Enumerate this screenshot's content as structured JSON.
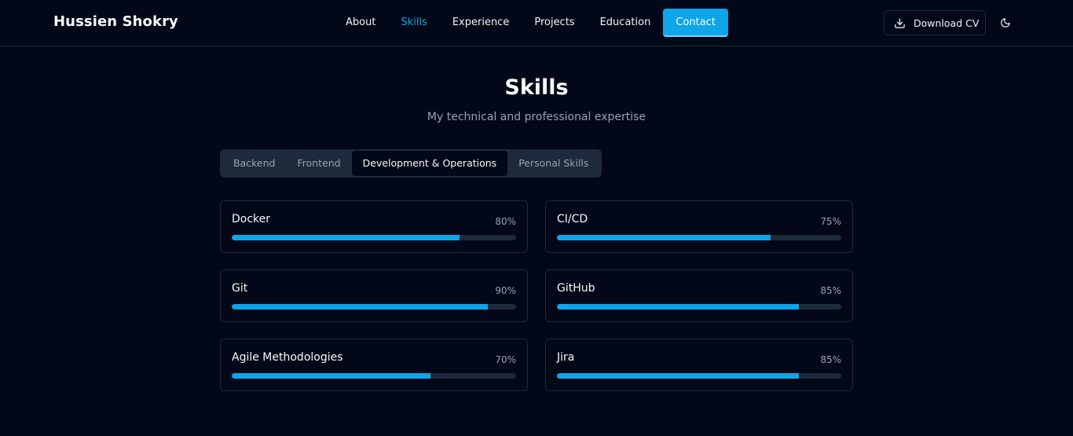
{
  "brand": "Hussien Shokry",
  "nav": {
    "links": [
      {
        "label": "About"
      },
      {
        "label": "Skills",
        "active": true
      },
      {
        "label": "Experience"
      },
      {
        "label": "Projects"
      },
      {
        "label": "Education"
      },
      {
        "label": "Contact",
        "cta": true
      }
    ],
    "download_label": "Download CV",
    "download_icon": "download-icon",
    "theme_icon": "moon-icon"
  },
  "section": {
    "title": "Skills",
    "subtitle": "My technical and professional expertise"
  },
  "tabs": [
    {
      "label": "Backend"
    },
    {
      "label": "Frontend"
    },
    {
      "label": "Development & Operations",
      "active": true
    },
    {
      "label": "Personal Skills"
    }
  ],
  "skills": [
    {
      "name": "Docker",
      "percent_label": "80%",
      "level": 0.8
    },
    {
      "name": "CI/CD",
      "percent_label": "75%",
      "level": 0.75
    },
    {
      "name": "Git",
      "percent_label": "90%",
      "level": 0.9
    },
    {
      "name": "GitHub",
      "percent_label": "85%",
      "level": 0.85
    },
    {
      "name": "Agile Methodologies",
      "percent_label": "70%",
      "level": 0.7
    },
    {
      "name": "Jira",
      "percent_label": "85%",
      "level": 0.85
    }
  ],
  "colors": {
    "accent": "#0ea5e9",
    "background": "#020817",
    "border": "#1e293b",
    "muted_text": "#94a3b8"
  }
}
